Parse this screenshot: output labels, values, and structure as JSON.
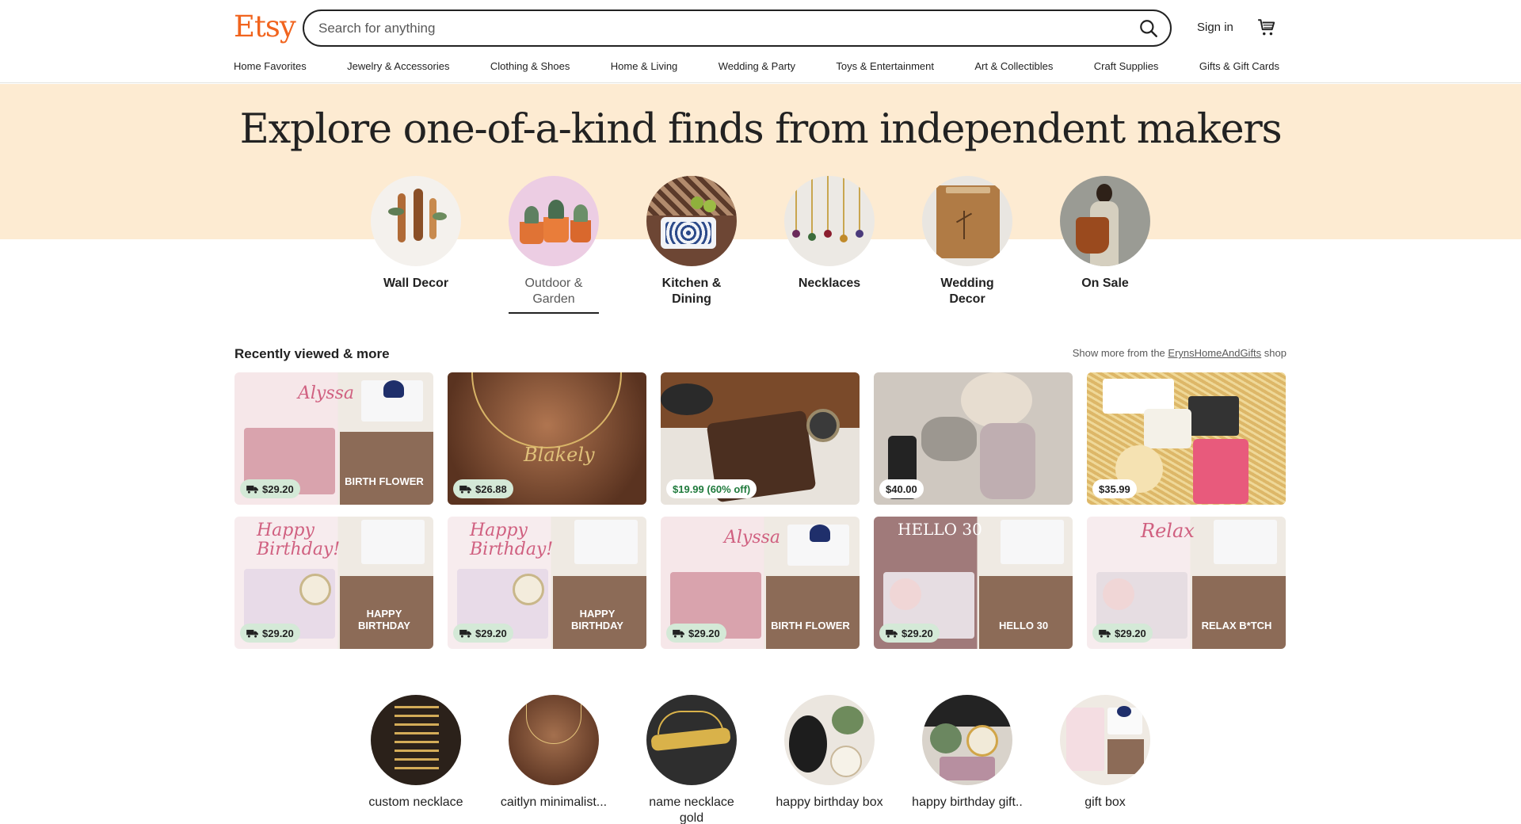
{
  "header": {
    "logo": "Etsy",
    "search_placeholder": "Search for anything",
    "signin": "Sign in"
  },
  "nav": [
    "Home Favorites",
    "Jewelry & Accessories",
    "Clothing & Shoes",
    "Home & Living",
    "Wedding & Party",
    "Toys & Entertainment",
    "Art & Collectibles",
    "Craft Supplies",
    "Gifts & Gift Cards"
  ],
  "hero": {
    "title": "Explore one-of-a-kind finds from independent makers",
    "categories": [
      "Wall Decor",
      "Outdoor & Garden",
      "Kitchen & Dining",
      "Necklaces",
      "Wedding Decor",
      "On Sale"
    ]
  },
  "recent": {
    "title": "Recently viewed & more",
    "more_prefix": "Show more from the",
    "shop_name": "ErynsHomeAndGifts",
    "more_suffix": "shop",
    "items": [
      {
        "price": "$29.20",
        "caption": "BIRTH FLOWER",
        "script": "Alyssa"
      },
      {
        "price": "$26.88",
        "caption": "",
        "script": ""
      },
      {
        "price": "$19.99 (60% off)",
        "caption": "",
        "script": ""
      },
      {
        "price": "$40.00",
        "caption": "",
        "script": ""
      },
      {
        "price": "$35.99",
        "caption": "",
        "script": ""
      },
      {
        "price": "$29.20",
        "caption": "HAPPY BIRTHDAY",
        "script": "Happy Birthday!"
      },
      {
        "price": "$29.20",
        "caption": "HAPPY BIRTHDAY",
        "script": "Happy Birthday!"
      },
      {
        "price": "$29.20",
        "caption": "BIRTH FLOWER",
        "script": "Alyssa"
      },
      {
        "price": "$29.20",
        "caption": "HELLO 30",
        "script": "HELLO 30"
      },
      {
        "price": "$29.20",
        "caption": "RELAX B*TCH",
        "script": "Relax"
      }
    ]
  },
  "searches": [
    "custom necklace",
    "caitlyn minimalist...",
    "name necklace gold",
    "happy birthday box",
    "happy birthday gift..",
    "gift box"
  ]
}
